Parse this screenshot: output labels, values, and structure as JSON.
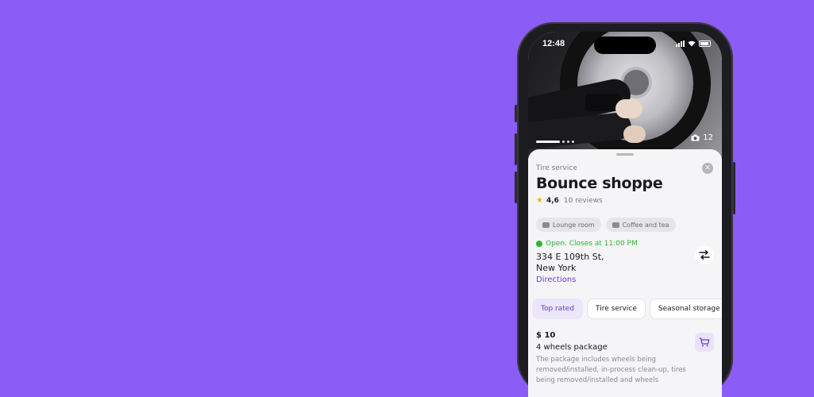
{
  "status": {
    "time": "12:48"
  },
  "hero": {
    "photo_count": "12",
    "icon": "camera-icon"
  },
  "shop": {
    "category": "Tire service",
    "name": "Bounce shoppe",
    "rating": "4,6",
    "reviews": "10 reviews"
  },
  "amenities": [
    {
      "label": "Lounge room",
      "icon": "sofa-icon"
    },
    {
      "label": "Coffee and tea",
      "icon": "coffee-icon"
    }
  ],
  "hours": {
    "status": "Open. Closes at 11:00 PM"
  },
  "location": {
    "address_line1": "334 E 109th St,",
    "address_line2": "New York",
    "directions_label": "Directions"
  },
  "tabs": [
    {
      "label": "Top rated",
      "active": true
    },
    {
      "label": "Tire service",
      "active": false
    },
    {
      "label": "Seasonal storage",
      "active": false
    }
  ],
  "package": {
    "price": "$ 10",
    "name": "4 wheels package",
    "description": "The package includes wheels being removed/installed, in-process clean-up, tires being removed/installed and wheels"
  },
  "colors": {
    "background": "#8b5cf6",
    "accent": "#6b3fd6",
    "open_green": "#2fb33a",
    "star": "#f5b400"
  }
}
